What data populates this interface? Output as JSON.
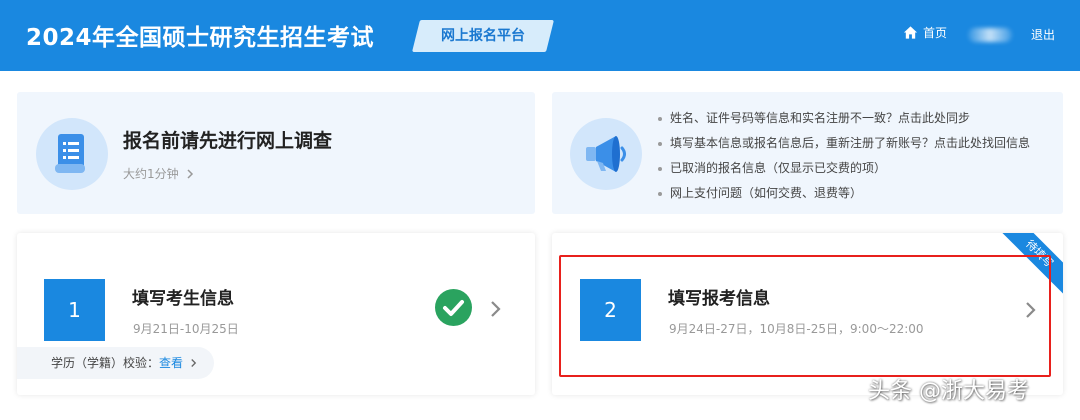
{
  "header": {
    "title": "2024年全国硕士研究生招生考试",
    "platform_badge": "网上报名平台",
    "home_label": "首页",
    "logout_label": "退出"
  },
  "survey_card": {
    "title": "报名前请先进行网上调查",
    "duration": "大约1分钟"
  },
  "notice_card": {
    "items": [
      "姓名、证件号码等信息和实名注册不一致？点击此处同步",
      "填写基本信息或报名信息后，重新注册了新账号？点击此处找回信息",
      "已取消的报名信息（仅显示已交费的项）",
      "网上支付问题（如何交费、退费等）"
    ]
  },
  "steps": [
    {
      "number": "1",
      "title": "填写考生信息",
      "dates": "9月21日-10月25日",
      "status": "completed",
      "verify_label": "学历（学籍）校验：",
      "verify_link": "查看"
    },
    {
      "number": "2",
      "title": "填写报考信息",
      "dates": "9月24日-27日，10月8日-25日，9:00～22:00",
      "ribbon": "待填写"
    }
  ],
  "watermark": "头条 @浙大易考",
  "colors": {
    "primary": "#1a88e0",
    "success": "#2aa35f",
    "highlight_border": "#e8201c"
  }
}
